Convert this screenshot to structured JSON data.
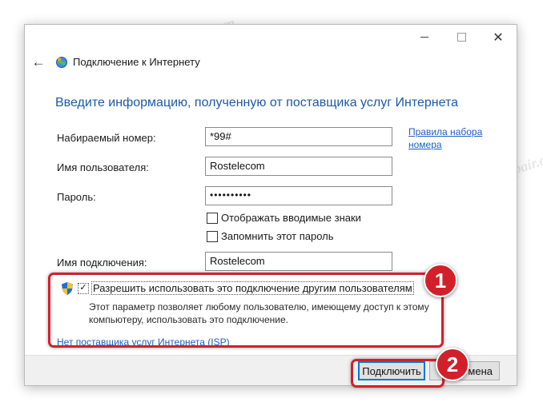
{
  "window": {
    "controls": {
      "minimize": "—",
      "maximize": "☐",
      "close": "✕"
    },
    "back_icon": "arrow-left",
    "title": "Подключение к Интернету"
  },
  "heading": "Введите информацию, полученную от поставщика услуг Интернета",
  "form": {
    "phone_label": "Набираемый номер:",
    "phone_value": "*99#",
    "dialing_rules_link": "Правила набора номера",
    "username_label": "Имя пользователя:",
    "username_value": "Rostelecom",
    "password_label": "Пароль:",
    "password_value": "••••••••••",
    "show_chars_label": "Отображать вводимые знаки",
    "show_chars_checked": false,
    "remember_password_label": "Запомнить этот пароль",
    "remember_password_checked": false,
    "connection_name_label": "Имя подключения:",
    "connection_name_value": "Rostelecom"
  },
  "sharing": {
    "checkbox_label": "Разрешить использовать это подключение другим пользователям",
    "checked": true,
    "checkmark": "✓",
    "description": "Этот параметр позволяет любому пользователю, имеющему доступ к этому компьютеру, использовать это подключение.",
    "no_isp_link": "Нет поставщика услуг Интернета (ISP)"
  },
  "buttons": {
    "connect": "Подключить",
    "cancel": "тмена"
  },
  "annotations": {
    "badge_1": "1",
    "badge_2": "2",
    "color": "#d2202a"
  },
  "watermark": "Soringpcrepair.com",
  "colors": {
    "heading": "#1e59a8",
    "link": "#1e5fc7",
    "highlight": "#d2202a"
  }
}
